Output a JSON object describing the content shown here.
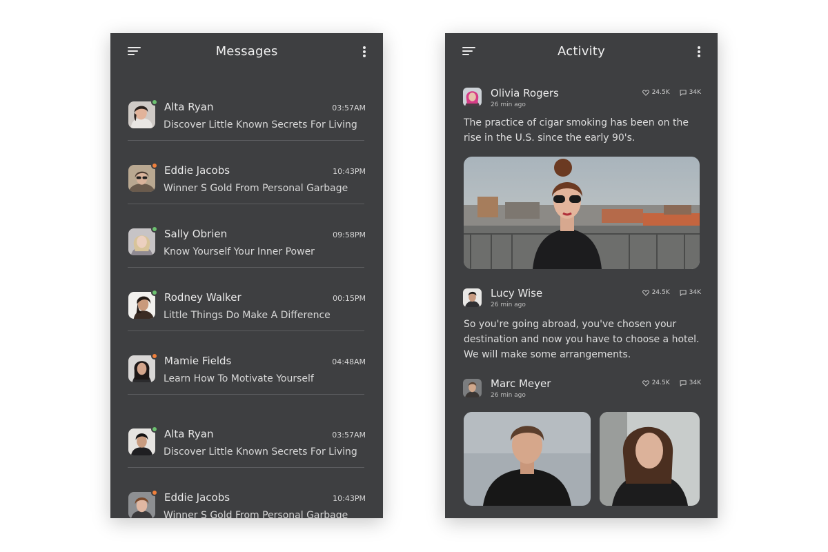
{
  "messages_screen": {
    "title": "Messages",
    "rows": [
      {
        "name": "Alta Ryan",
        "time": "03:57AM",
        "text": "Discover Little Known Secrets For Living",
        "status": "#6cc070"
      },
      {
        "name": "Eddie Jacobs",
        "time": "10:43PM",
        "text": "Winner S Gold From Personal Garbage",
        "status": "#f0803c"
      },
      {
        "name": "Sally Obrien",
        "time": "09:58PM",
        "text": "Know Yourself Your Inner Power",
        "status": "#6cc070"
      },
      {
        "name": "Rodney Walker",
        "time": "00:15PM",
        "text": "Little Things Do Make A Difference",
        "status": "#6cc070"
      },
      {
        "name": "Mamie Fields",
        "time": "04:48AM",
        "text": "Learn How To Motivate Yourself",
        "status": "#f0803c"
      },
      {
        "name": "Alta Ryan",
        "time": "03:57AM",
        "text": "Discover Little Known Secrets For Living",
        "status": "#6cc070"
      },
      {
        "name": "Eddie Jacobs",
        "time": "10:43PM",
        "text": "Winner S Gold From Personal Garbage",
        "status": "#f0803c"
      }
    ]
  },
  "activity_screen": {
    "title": "Activity",
    "posts": [
      {
        "name": "Olivia Rogers",
        "time": "26 min ago",
        "likes": "24.5K",
        "comments": "34K",
        "text": "The practice of cigar smoking has been on the rise in the U.S. since the early 90's."
      },
      {
        "name": "Lucy Wise",
        "time": "26 min ago",
        "likes": "24.5K",
        "comments": "34K",
        "text": "So you're going abroad, you've chosen your destination and now you have to choose a hotel. We will make some arrangements."
      },
      {
        "name": "Marc Meyer",
        "time": "26 min ago",
        "likes": "24.5K",
        "comments": "34K"
      }
    ]
  },
  "colors": {
    "screen_background": "#3e3f41",
    "status_online": "#6cc070",
    "status_away": "#f0803c"
  },
  "icons": [
    "menu-icon",
    "more-options-icon",
    "heart-icon",
    "comment-icon"
  ]
}
